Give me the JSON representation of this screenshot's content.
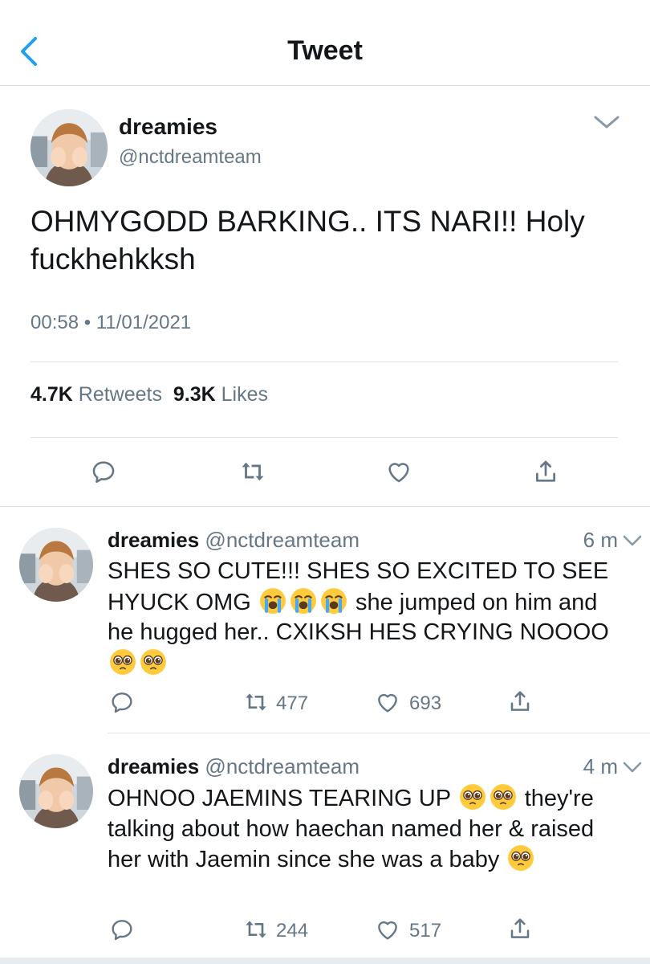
{
  "header": {
    "title": "Tweet"
  },
  "main_tweet": {
    "display_name": "dreamies",
    "handle": "@nctdreamteam",
    "text": "OHMYGODD BARKING.. ITS NARI!! Holy fuckhehkksh",
    "timestamp": "00:58 • 11/01/2021",
    "retweet_count": "4.7K",
    "retweet_label": "Retweets",
    "like_count": "9.3K",
    "like_label": "Likes"
  },
  "replies": [
    {
      "display_name": "dreamies",
      "handle": "@nctdreamteam",
      "time": "6 m",
      "text_parts": [
        "SHES SO CUTE!!! SHES SO EXCITED TO SEE HYUCK OMG",
        "she jumped on him and he hugged her.. CXIKSH HES CRYING NOOOO"
      ],
      "emoji_1": "loudly-crying-face",
      "emoji_2": "pleading-face",
      "retweets": "477",
      "likes": "693"
    },
    {
      "display_name": "dreamies",
      "handle": "@nctdreamteam",
      "time": "4 m",
      "text_parts": [
        "OHNOO JAEMINS TEARING UP",
        "they're talking about how haechan named her & raised her with Jaemin since she was a baby"
      ],
      "emoji": "pleading-face",
      "retweets": "244",
      "likes": "517"
    }
  ],
  "icons": [
    "back-chevron-icon",
    "chevron-down-icon",
    "reply-icon",
    "retweet-icon",
    "like-icon",
    "share-icon"
  ],
  "colors": {
    "accent": "#1da1f2",
    "secondary_text": "#657786",
    "icon_gray": "#657786"
  }
}
